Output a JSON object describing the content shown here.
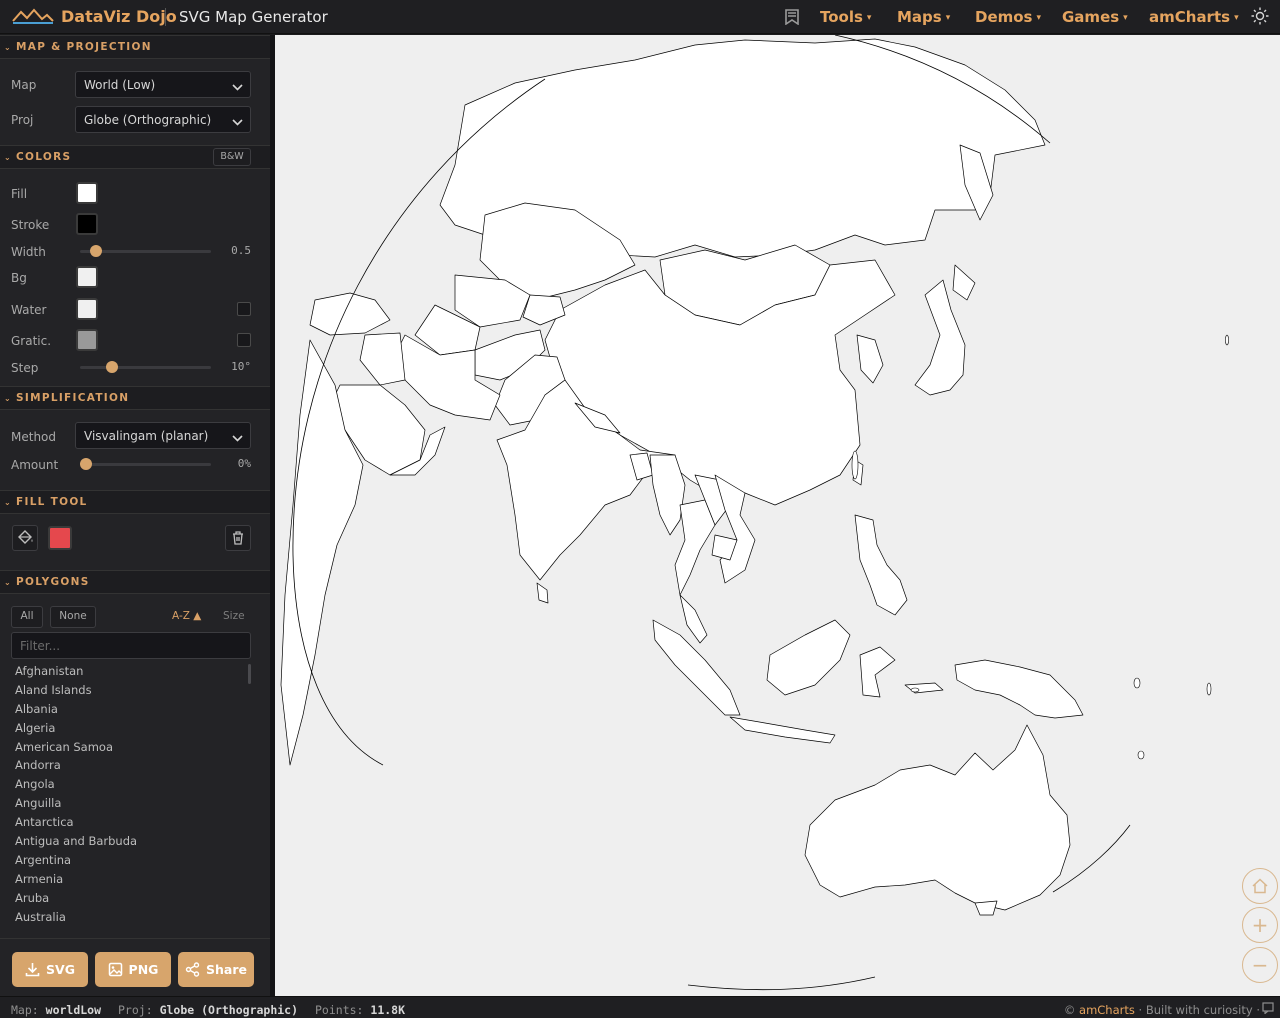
{
  "header": {
    "brand": "DataViz Dojo",
    "app_title": "SVG Map Generator",
    "nav": [
      {
        "label": "Tools"
      },
      {
        "label": "Maps"
      },
      {
        "label": "Demos"
      },
      {
        "label": "Games"
      },
      {
        "label": "amCharts"
      }
    ]
  },
  "sections": {
    "map_projection": {
      "title": "MAP & PROJECTION",
      "map_label": "Map",
      "map_value": "World (Low)",
      "proj_label": "Proj",
      "proj_value": "Globe (Orthographic)"
    },
    "colors": {
      "title": "COLORS",
      "bw_button": "B&W",
      "fill_label": "Fill",
      "fill_color": "#ffffff",
      "stroke_label": "Stroke",
      "stroke_color": "#000000",
      "width_label": "Width",
      "width_value": "0.5",
      "width_fraction": 0.08,
      "bg_label": "Bg",
      "bg_color": "#f0f0f0",
      "water_label": "Water",
      "water_color": "#f0f0f0",
      "water_checked": false,
      "gratic_label": "Gratic.",
      "gratic_color": "#999999",
      "gratic_checked": false,
      "step_label": "Step",
      "step_value": "10°",
      "step_fraction": 0.2
    },
    "simplification": {
      "title": "SIMPLIFICATION",
      "method_label": "Method",
      "method_value": "Visvalingam (planar)",
      "amount_label": "Amount",
      "amount_value": "0%",
      "amount_fraction": 0
    },
    "fill_tool": {
      "title": "FILL TOOL",
      "paint_color": "#e5484d"
    },
    "polygons": {
      "title": "POLYGONS",
      "all_button": "All",
      "none_button": "None",
      "sort_az": "A-Z ▲",
      "sort_size": "Size",
      "filter_placeholder": "Filter...",
      "items": [
        "Afghanistan",
        "Aland Islands",
        "Albania",
        "Algeria",
        "American Samoa",
        "Andorra",
        "Angola",
        "Anguilla",
        "Antarctica",
        "Antigua and Barbuda",
        "Argentina",
        "Armenia",
        "Aruba",
        "Australia"
      ]
    }
  },
  "export": {
    "svg_label": "SVG",
    "png_label": "PNG",
    "share_label": "Share"
  },
  "status": {
    "map_key": "Map:",
    "map_val": "worldLow",
    "proj_key": "Proj:",
    "proj_val": "Globe (Orthographic)",
    "points_key": "Points:",
    "points_val": "11.8K",
    "credit_prefix": "©",
    "credit_brand": "amCharts",
    "credit_suffix": "· Built with curiosity ·"
  },
  "colors": {
    "accent": "#e5a45f",
    "map_bg": "#efefef"
  }
}
